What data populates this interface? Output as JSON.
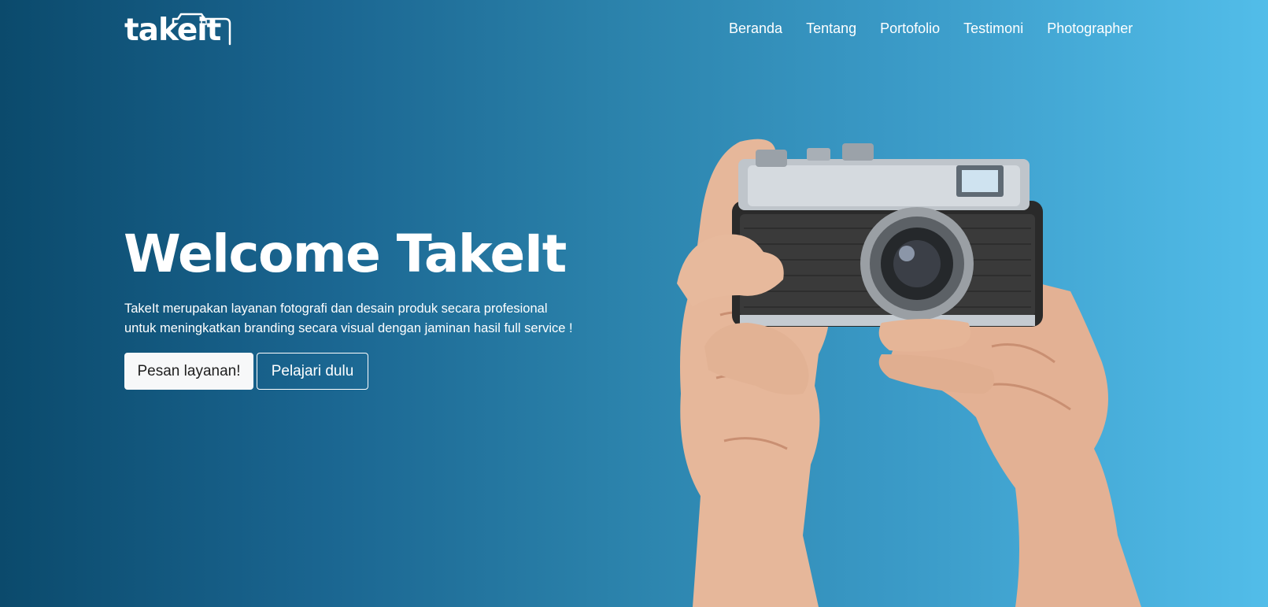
{
  "brand": {
    "logo_text": "takeit"
  },
  "nav": {
    "items": [
      {
        "label": "Beranda"
      },
      {
        "label": "Tentang"
      },
      {
        "label": "Portofolio"
      },
      {
        "label": "Testimoni"
      },
      {
        "label": "Photographer"
      }
    ]
  },
  "hero": {
    "title": "Welcome TakeIt",
    "description_line1": "TakeIt merupakan layanan fotografi dan desain produk secara profesional",
    "description_line2": "untuk meningkatkan branding secara visual dengan jaminan hasil full service !",
    "primary_button": "Pesan layanan!",
    "secondary_button": "Pelajari dulu"
  },
  "colors": {
    "gradient_start": "#0b4a6c",
    "gradient_end": "#52bde9",
    "text": "#ffffff",
    "primary_button_bg": "#f7f8f9"
  },
  "image": {
    "subject": "hands holding vintage camera"
  }
}
